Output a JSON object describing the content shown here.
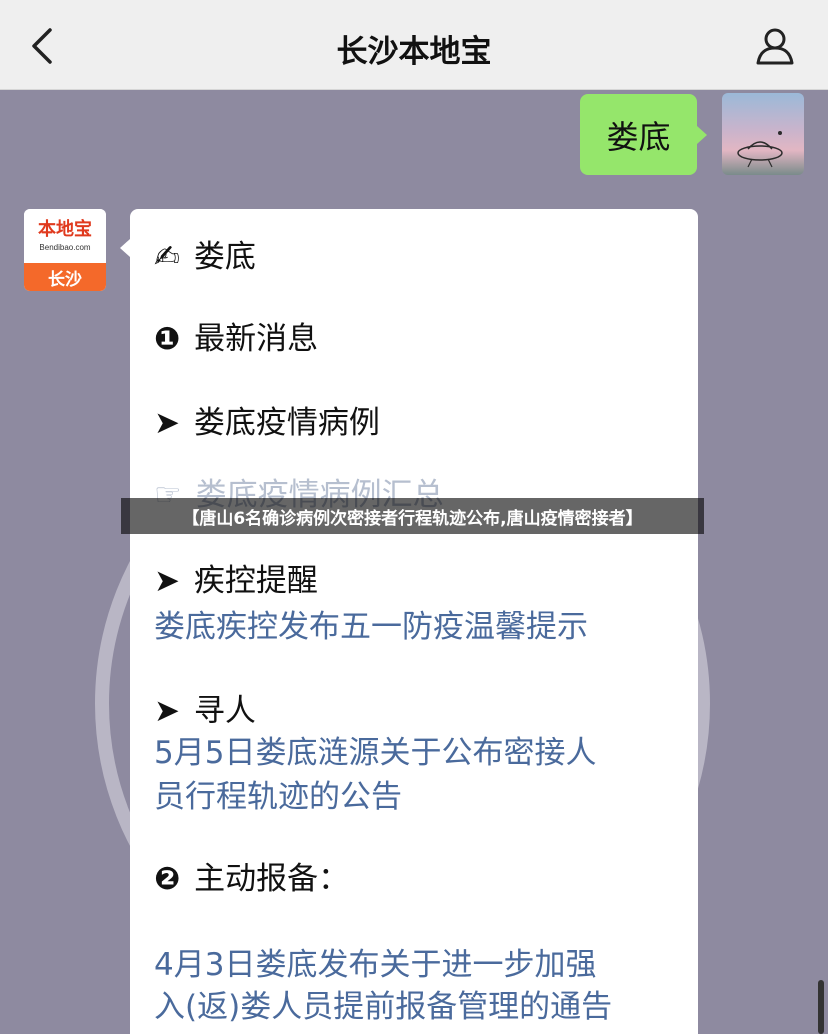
{
  "header": {
    "title": "长沙本地宝",
    "back_icon": "chevron-left-icon",
    "profile_icon": "person-icon"
  },
  "outgoing": {
    "text": "娄底"
  },
  "bot": {
    "logo_main": "本地宝",
    "logo_url": "Bendibao.com",
    "logo_city": "长沙"
  },
  "message": {
    "title_emoji": "✍",
    "title": "娄底",
    "section1_mark": "❶",
    "section1": "最新消息",
    "item1_mark": "➤",
    "item1": "娄底疫情病例",
    "item1_link_mark": "☞",
    "item1_link": "娄底疫情病例汇总",
    "item2_mark": "➤",
    "item2": "疾控提醒",
    "item2_link": "娄底疾控发布五一防疫温馨提示",
    "item3_mark": "➤",
    "item3": "寻人",
    "item3_link_line1": "5月5日娄底涟源关于公布密接人",
    "item3_link_line2": "员行程轨迹的公告",
    "section2_mark": "❷",
    "section2": "主动报备：",
    "item4_link_line1": "4月3日娄底发布关于进一步加强",
    "item4_link_line2": "入(返)娄人员提前报备管理的通告"
  },
  "banner": {
    "text": "【唐山6名确诊病例次密接者行程轨迹公布,唐山疫情密接者】"
  },
  "colors": {
    "chat_background": "#8e8aa0",
    "outgoing_bubble": "#95e66b",
    "link": "#4a6a9c",
    "logo_orange": "#f4692a"
  }
}
